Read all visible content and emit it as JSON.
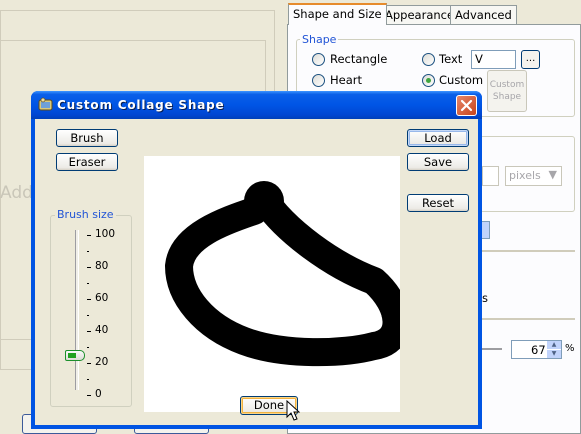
{
  "main": {
    "add_text": "Add"
  },
  "tabs": [
    {
      "label": "Shape and Size",
      "active": true
    },
    {
      "label": "Appearance",
      "active": false
    },
    {
      "label": "Advanced",
      "active": false
    }
  ],
  "shape_group": {
    "title": "Shape",
    "options": [
      {
        "label": "Rectangle",
        "checked": false
      },
      {
        "label": "Text",
        "checked": false
      },
      {
        "label": "Heart",
        "checked": false
      },
      {
        "label": "Custom",
        "checked": true
      }
    ],
    "text_value": "V",
    "browse_label": "...",
    "custom_shape_button": [
      "Custom",
      "Shape"
    ]
  },
  "size": {
    "unit": "pixels",
    "percent_value": "67",
    "percent_unit": "%",
    "partial_label": "s"
  },
  "dialog": {
    "title": "Custom Collage Shape",
    "brush_label": "Brush",
    "eraser_label": "Eraser",
    "brush_size_title": "Brush size",
    "brush_size_value": 25,
    "scale_labels": [
      "100",
      "80",
      "60",
      "40",
      "20",
      "0"
    ],
    "load_label": "Load",
    "save_label": "Save",
    "reset_label": "Reset",
    "done_label": "Done"
  },
  "colors": {
    "accent_blue": "#0054e3",
    "tab_highlight": "#e68b2c",
    "group_title": "#2154d6",
    "window_bg": "#ece9d8",
    "close_red": "#c8441c",
    "brush_stroke": "#000000"
  }
}
